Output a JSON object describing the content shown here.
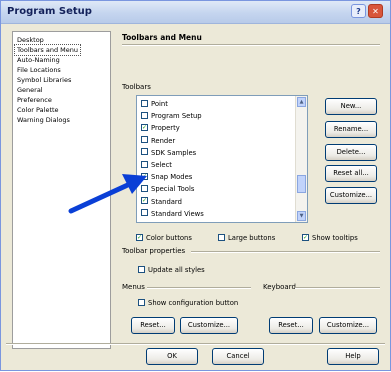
{
  "window": {
    "title": "Program Setup"
  },
  "categories": [
    {
      "label": "Desktop",
      "selected": false
    },
    {
      "label": "Toolbars and Menu",
      "selected": true
    },
    {
      "label": "Auto-Naming",
      "selected": false
    },
    {
      "label": "File Locations",
      "selected": false
    },
    {
      "label": "Symbol Libraries",
      "selected": false
    },
    {
      "label": "General",
      "selected": false
    },
    {
      "label": "Preference",
      "selected": false
    },
    {
      "label": "Color Palette",
      "selected": false
    },
    {
      "label": "Warning Dialogs",
      "selected": false
    }
  ],
  "section_title": "Toolbars and Menu",
  "toolbars_label": "Toolbars",
  "toolbars": [
    {
      "label": "Point",
      "checked": false
    },
    {
      "label": "Program Setup",
      "checked": false
    },
    {
      "label": "Property",
      "checked": true
    },
    {
      "label": "Render",
      "checked": false
    },
    {
      "label": "SDK Samples",
      "checked": false
    },
    {
      "label": "Select",
      "checked": false
    },
    {
      "label": "Snap Modes",
      "checked": true
    },
    {
      "label": "Special Tools",
      "checked": false
    },
    {
      "label": "Standard",
      "checked": true
    },
    {
      "label": "Standard Views",
      "checked": false
    }
  ],
  "toolbar_buttons": {
    "new": "New...",
    "rename": "Rename...",
    "delete": "Delete...",
    "reset_all": "Reset all...",
    "customize": "Customize..."
  },
  "options": {
    "color_buttons": "Color buttons",
    "large_buttons": "Large buttons",
    "show_tooltips": "Show tooltips",
    "color_buttons_checked": true,
    "large_buttons_checked": false,
    "show_tooltips_checked": true
  },
  "toolbar_properties": {
    "label": "Toolbar properties",
    "update_all_styles": "Update all styles",
    "update_all_styles_checked": false
  },
  "menus": {
    "label": "Menus",
    "show_config_button": "Show configuration button",
    "show_config_button_checked": false,
    "reset": "Reset...",
    "customize": "Customize..."
  },
  "keyboard": {
    "label": "Keyboard",
    "reset": "Reset...",
    "customize": "Customize..."
  },
  "footer": {
    "ok": "OK",
    "cancel": "Cancel",
    "help": "Help"
  },
  "colors": {
    "accent": "#0a3fd6",
    "window_bg": "#ece9d8",
    "title_text": "#13215a"
  }
}
